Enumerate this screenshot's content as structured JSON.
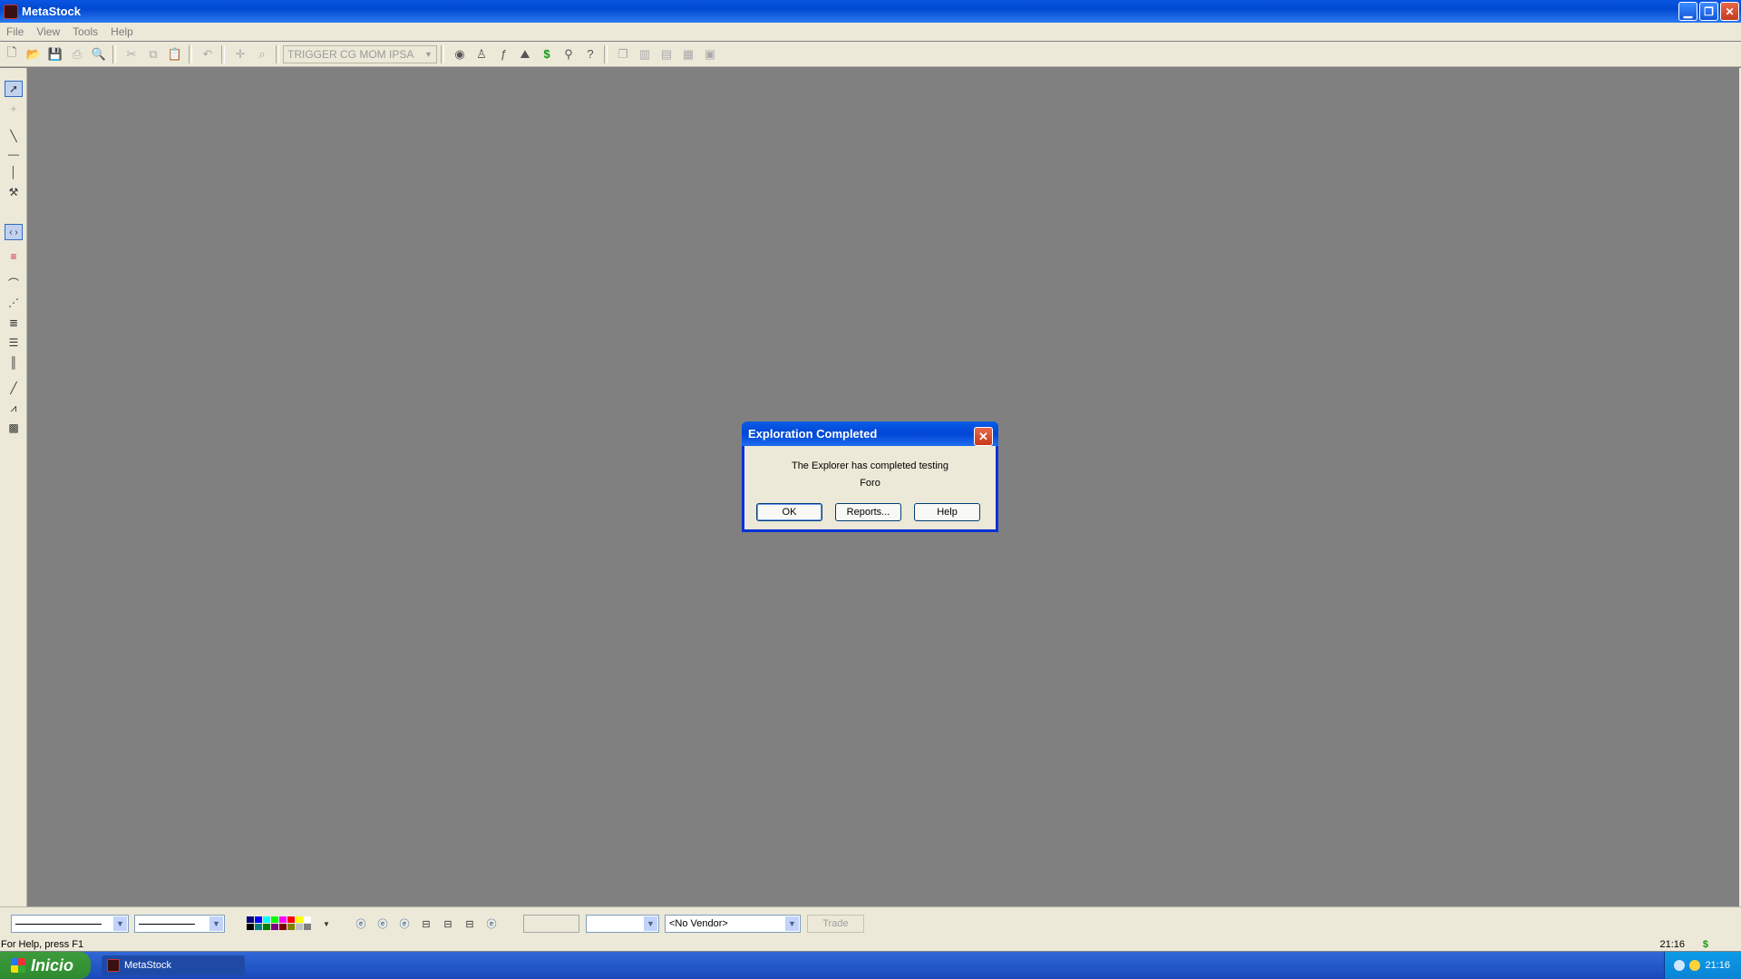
{
  "window": {
    "title": "MetaStock",
    "min_glyph": "▁",
    "restore_glyph": "❐",
    "close_glyph": "✕"
  },
  "menu": [
    "File",
    "View",
    "Tools",
    "Help"
  ],
  "toolbar": {
    "expert_combo": "TRIGGER CG MOM IPSA"
  },
  "dialog": {
    "title": "Exploration Completed",
    "message_line1": "The Explorer has completed testing",
    "message_line2": "Foro",
    "ok_label": "OK",
    "reports_label": "Reports...",
    "help_label": "Help",
    "close_glyph": "✕"
  },
  "bottom": {
    "vendor_combo": "<No Vendor>",
    "trade_label": "Trade"
  },
  "status": {
    "message": "For Help, press F1",
    "time": "21:16",
    "dollar": "$"
  },
  "taskbar": {
    "start_label": "Inicio",
    "task_label": "MetaStock",
    "clock": "21:16"
  },
  "colors": {
    "workspace": "#808080",
    "chrome": "#ece9d8",
    "title_blue": "#0a56e2",
    "palette": [
      "#000080",
      "#0000ff",
      "#00ffff",
      "#00ff00",
      "#ff00ff",
      "#ff0000",
      "#ffff00",
      "#ffffff",
      "#000000",
      "#008080",
      "#008000",
      "#800080",
      "#800000",
      "#808000",
      "#c0c0c0",
      "#808080"
    ]
  }
}
